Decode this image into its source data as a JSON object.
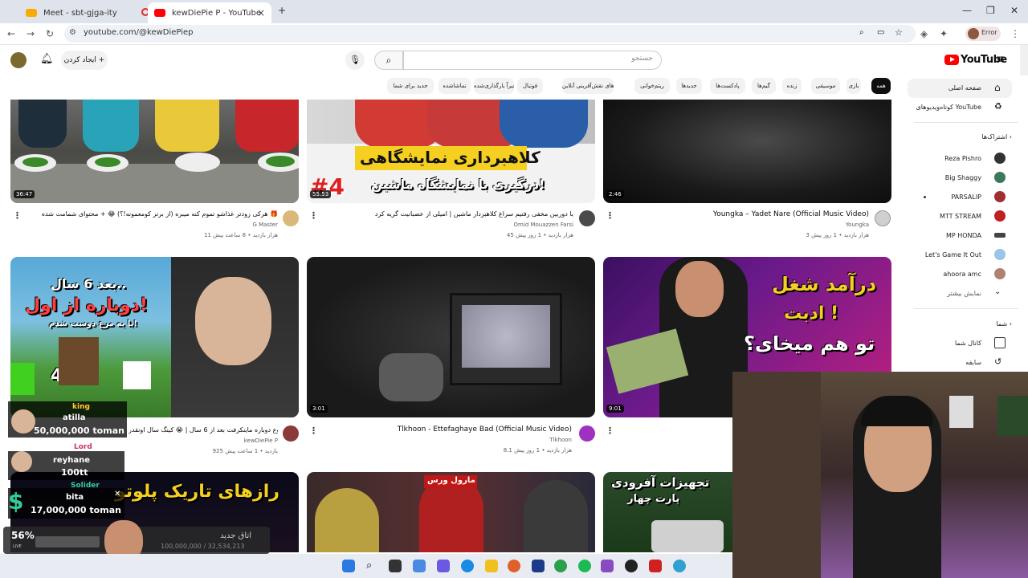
{
  "browser": {
    "tabs": [
      {
        "title": "Meet - sbt-gjga-ity",
        "active": false
      },
      {
        "title": "kewDiePie P - YouTube",
        "active": true
      }
    ],
    "new_tab": "+",
    "url": "youtube.com/@kewDiePiep",
    "profile_label": "Error"
  },
  "header": {
    "logo": "YouTube",
    "search_placeholder": "جستجو",
    "create_label": "ایجاد کردن"
  },
  "chips": [
    "همه",
    "بازی",
    "موسیقی",
    "زنده",
    "گیم‌ها",
    "پادکست‌ها",
    "جدیدها",
    "ریتم‌خوانی",
    "بازی‌های نقش‌آفرینی آنلاین",
    "فوتبال",
    "اخیراً بارگذاری‌شده",
    "تماشاشده",
    "جدید برای شما"
  ],
  "sidebar": {
    "home": "صفحه اصلی",
    "shorts": "کوتاه‌ویدیوهای YouTube",
    "subs_heading": "اشتراک‌ها",
    "subscriptions": [
      "Reza Pishro",
      "Big Shaggy",
      "PARSALIP",
      "MTT STREAM",
      "MP HONDA",
      "Let's Game It Out",
      "ahoora amc"
    ],
    "show_more": "نمایش بیشتر",
    "you_heading": "شما",
    "your_channel": "کانال شما",
    "history": "سابقه"
  },
  "videos": [
    {
      "title": "هرکی زودتر غذاشو تموم کنه میبره (از برتر کومعمونه!؟) 😂 + محتوای شمامت شده 🎁",
      "channel": "G Master",
      "meta": "11 هزار بازدید • 8 ساعت پیش",
      "duration": "36:47"
    },
    {
      "title": "با دوربین مخفی رفتیم سراغ کلاهبردار ماشین | امیلی از عصبانیت گریه کرد",
      "channel": "Omid Mouazzen Farsi",
      "meta": "45 هزار بازدید • 1 روز پیش",
      "duration": "55:53",
      "overlay": "کلاهبرداری نمایشگاهی",
      "overlay2": "درگیری با نمایشگاه ماشین!",
      "num": "#4"
    },
    {
      "title": "Youngka – Yadet Nare (Official Music Video)",
      "channel": "Youngka",
      "meta": "3 هزار بازدید • 1 روز پیش",
      "duration": "2:46"
    },
    {
      "title": "شروع دوباره ماینکرفت بعد از 6 سال | 😭 کینگ سال اونقدر",
      "channel": "kewDiePie P",
      "meta": "925 بازدید • 1 ساعت پیش",
      "duration": "",
      "overlay": "بعد 6 سال..",
      "overlay2": "دوباره از اول!",
      "overlay3": "با یه مرغ دوست شدم!",
      "num": "49"
    },
    {
      "title": "Tlkhoon - Ettefaghaye Bad (Official Music Video)",
      "channel": "Tlkhoon",
      "meta": "8.1 هزار بازدید • 1 روز پیش",
      "duration": "3:01"
    },
    {
      "title": "",
      "channel": "",
      "meta": "",
      "duration": "9:01",
      "overlay": "درآمد شغل",
      "overlay2": "ادبت !",
      "overlay3": "تو هم میخای؟"
    },
    {
      "overlay": "رازهای تاریک پلوتو"
    },
    {
      "overlay": "مارول ورس"
    },
    {
      "overlay": "تجهیزات آفرودی",
      "overlay2": "پارت چهار"
    }
  ],
  "stream": {
    "donations": [
      {
        "rank": "king",
        "name": "atilla",
        "amount": "50,000,000 toman"
      },
      {
        "rank": "Lord",
        "name": "reyhane",
        "amount": "100tt"
      },
      {
        "rank": "Solider",
        "name": "bita",
        "amount": "17,000,000 toman"
      }
    ],
    "hp": "56%",
    "room_label": "اتاق جدید",
    "live_label": "LIVE",
    "money": "100,000,000 / 32,534,213"
  },
  "colors": {
    "yt_red": "#ff0000",
    "chip_sel": "#0f0f0f",
    "king": "#ffcc33",
    "lord": "#cc3366",
    "solider": "#33cc99"
  }
}
